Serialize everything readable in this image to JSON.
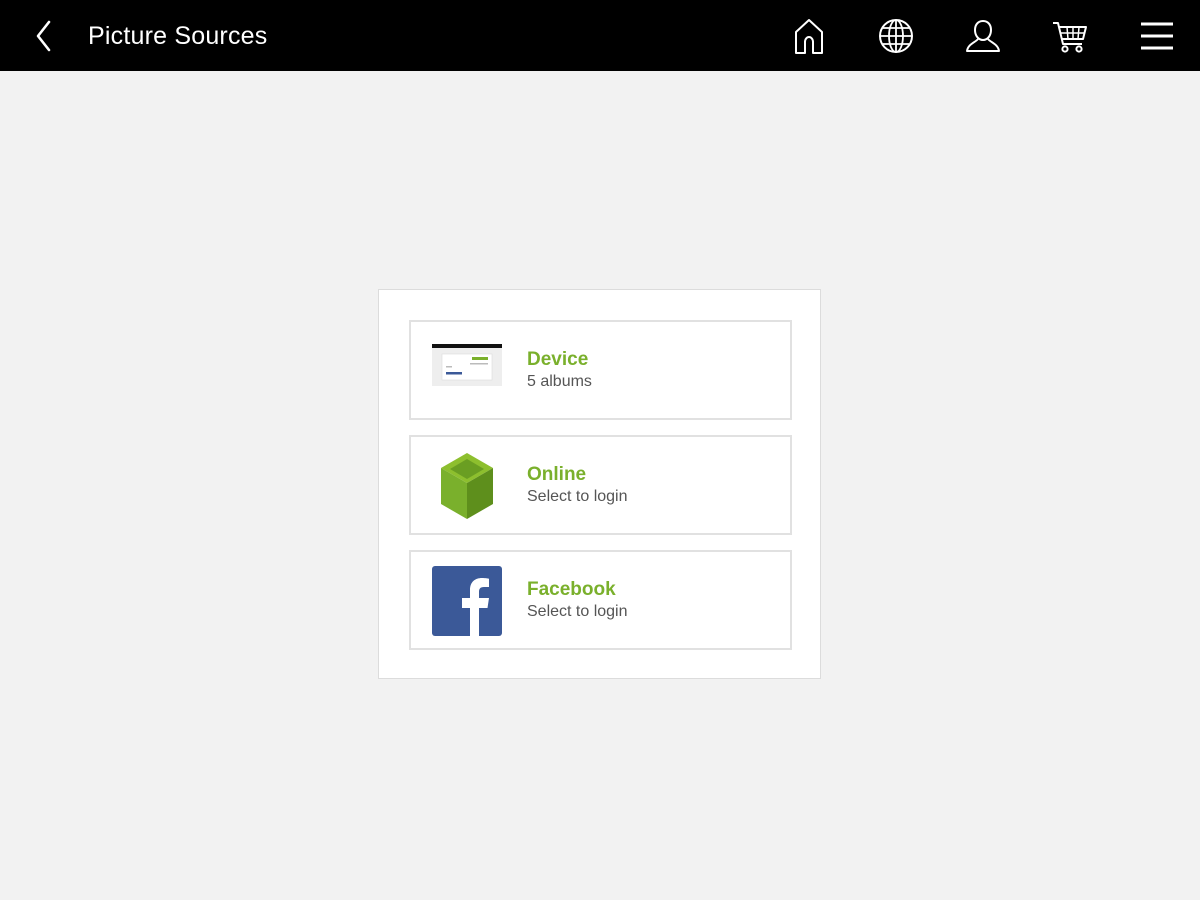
{
  "header": {
    "title": "Picture Sources",
    "back_icon": "chevron-left-icon",
    "nav_icons": [
      "home-icon",
      "globe-icon",
      "user-icon",
      "cart-icon",
      "hamburger-menu-icon"
    ]
  },
  "sources": [
    {
      "title": "Device",
      "subtitle": "5 albums",
      "icon": "device-screenshot-thumbnail"
    },
    {
      "title": "Online",
      "subtitle": "Select to login",
      "icon": "green-box-icon"
    },
    {
      "title": "Facebook",
      "subtitle": "Select to login",
      "icon": "facebook-icon"
    }
  ],
  "colors": {
    "header_bg": "#000000",
    "page_bg": "#f2f2f2",
    "accent_green": "#7ab02c",
    "facebook_blue": "#3b5998",
    "subtitle_text": "#555555"
  }
}
